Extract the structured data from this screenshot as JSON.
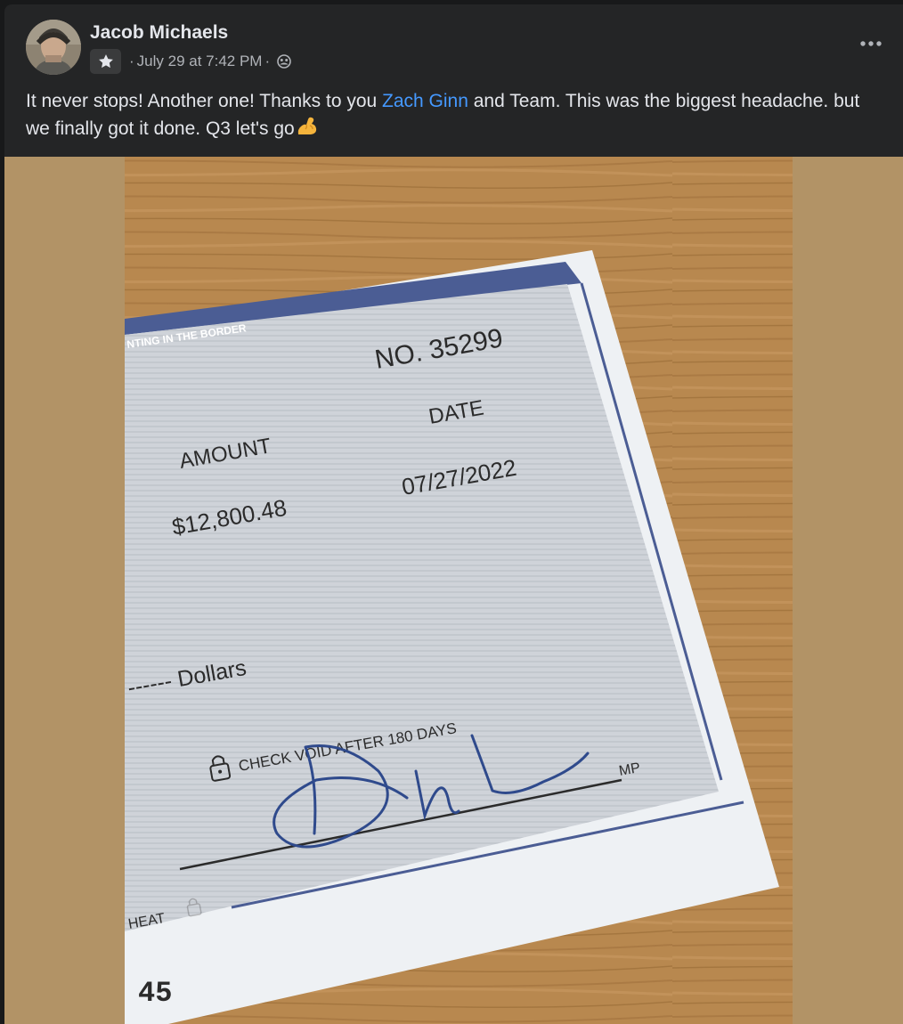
{
  "post": {
    "author": "Jacob Michaels",
    "timestamp": "July 29 at 7:42 PM",
    "separator": "·",
    "badge_icon": "star-icon",
    "audience_icon": "friends-icon",
    "more_icon": "ellipsis-icon",
    "text_before": "It never stops! Another one! Thanks to you ",
    "mention": "Zach Ginn",
    "text_after": " and Team. This was the biggest headache. but we finally got it done. Q3 let's go",
    "emoji": "flexed-biceps-emoji",
    "colors": {
      "background": "#242526",
      "text": "#e4e6eb",
      "secondary": "#b0b3b8",
      "mention": "#4599ff"
    }
  },
  "check": {
    "border_text": "NTING IN THE BORDER",
    "number": "NO. 35299",
    "date_label": "DATE",
    "date": "07/27/2022",
    "amount_label": "AMOUNT",
    "amount": "$12,800.48",
    "dollars": "------ Dollars",
    "void_notice": "CHECK VOID AFTER 180 DAYS",
    "mp": "MP",
    "heat": "HEAT",
    "micr": "45"
  }
}
